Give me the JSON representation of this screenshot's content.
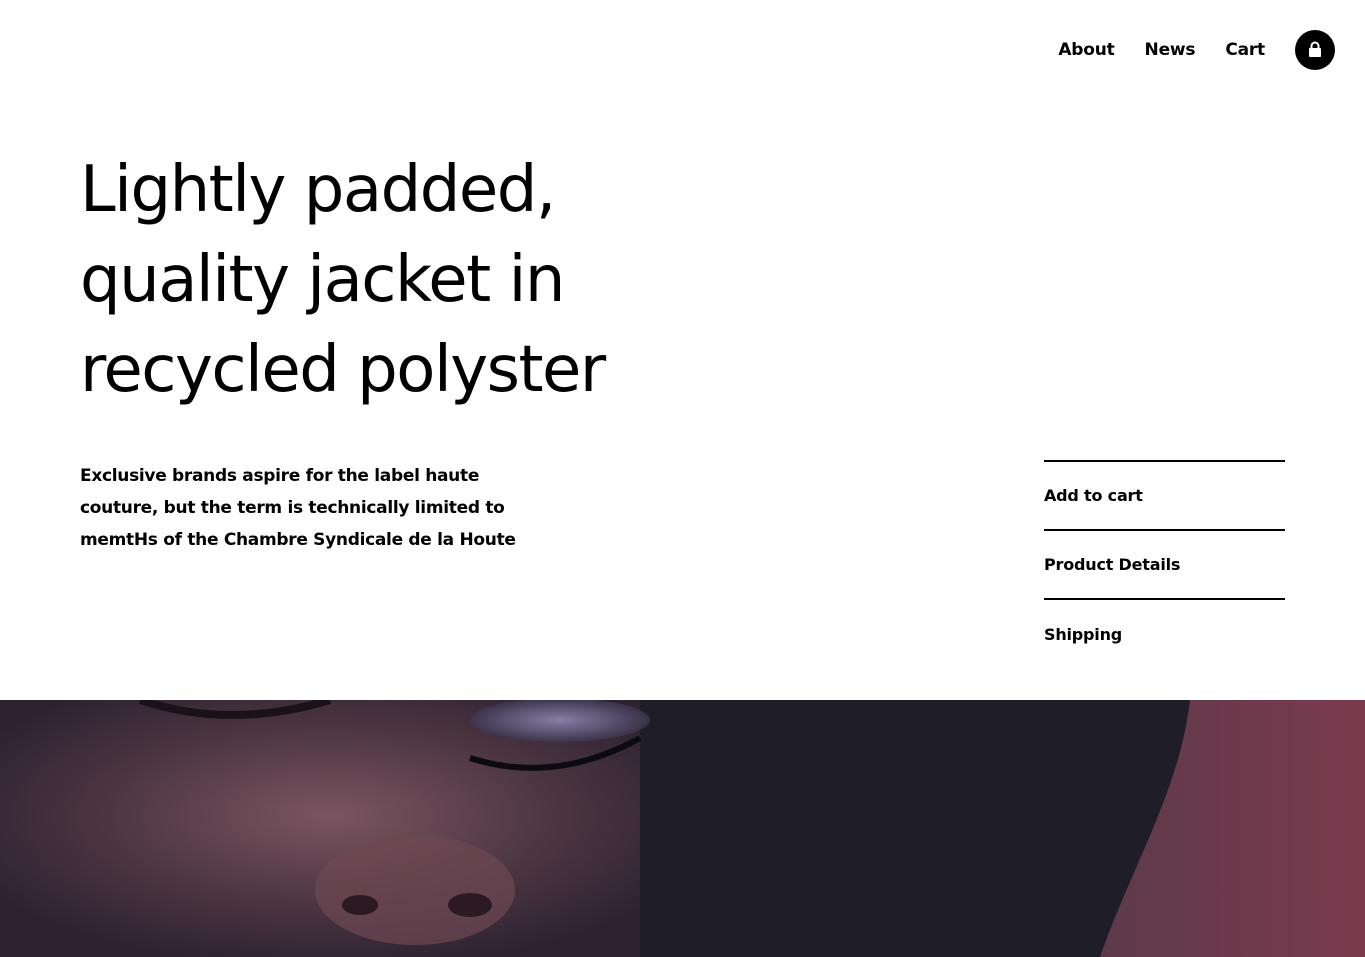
{
  "nav": {
    "about_label": "About",
    "news_label": "News",
    "cart_label": "Cart",
    "cart_icon": "shopping-bag-icon"
  },
  "product": {
    "headline_line1": "Lightly padded,",
    "headline_line2": "quality jacket in",
    "headline_line3": "recycled polyster",
    "description_line1": "Exclusive brands aspire for the label haute",
    "description_line2": "couture, but the term is technically limited to",
    "description_line3": "memtHs of the Chambre Syndicale de la Houte"
  },
  "actions": {
    "add_to_cart": "Add to cart",
    "product_details": "Product Details",
    "shipping": "Shipping"
  },
  "colors": {
    "text": "#000000",
    "background": "#ffffff",
    "hero_backdrop": "#7a3a4e"
  }
}
